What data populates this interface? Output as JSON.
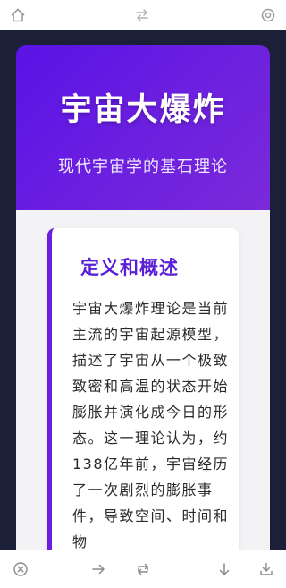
{
  "hero": {
    "title": "宇宙大爆炸",
    "subtitle": "现代宇宙学的基石理论"
  },
  "card": {
    "title": "定义和概述",
    "body": "宇宙大爆炸理论是当前主流的宇宙起源模型，描述了宇宙从一个极致致密和高温的状态开始膨胀并演化成今日的形态。这一理论认为，约138亿年前，宇宙经历了一次剧烈的膨胀事件，导致空间、时间和物"
  },
  "icons": {
    "top": [
      "home-icon",
      "swap-icon",
      "gear-icon"
    ],
    "bottom": [
      "close-circle-icon",
      "arrow-right-icon",
      "refresh-icon",
      "arrow-down-icon",
      "download-icon"
    ]
  },
  "colors": {
    "hero_gradient_start": "#5a12e6",
    "hero_gradient_end": "#7a2ad9",
    "accent": "#6a1fe0",
    "page_background": "#1c1f38"
  }
}
